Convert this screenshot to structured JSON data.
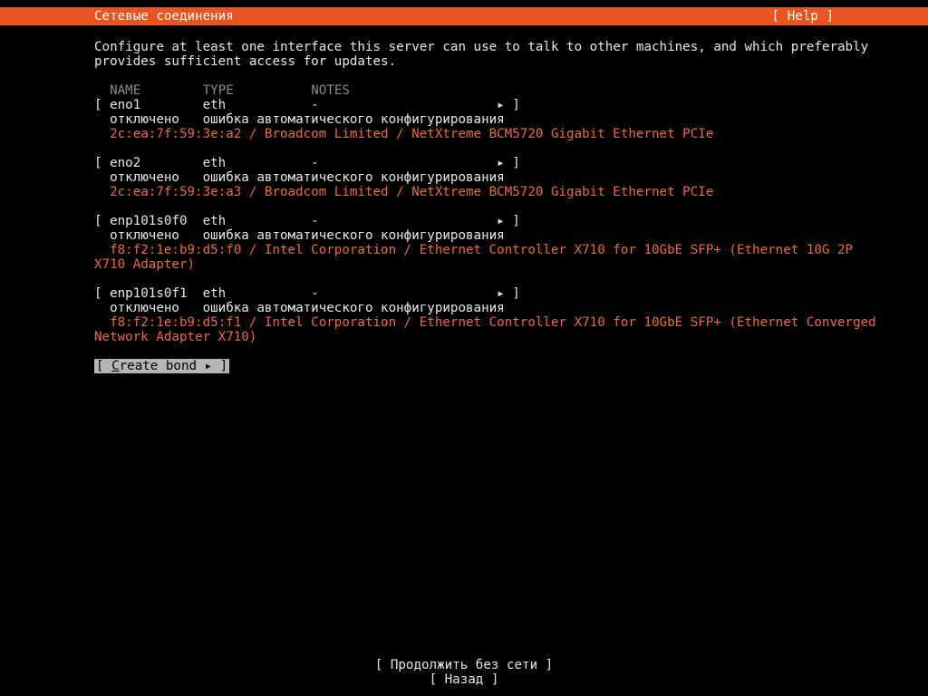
{
  "header": {
    "title": "Сетевые соединения",
    "help": "[ Help ]"
  },
  "intro": "Configure at least one interface this server can use to talk to other machines, and which preferably\nprovides sufficient access for updates.",
  "columns": {
    "name": "NAME",
    "type": "TYPE",
    "notes": "NOTES"
  },
  "interfaces": [
    {
      "name": "eno1",
      "type": "eth",
      "notes": "-",
      "state": "отключено",
      "reason": "ошибка автоматического конфигурирования",
      "hw": "2c:ea:7f:59:3e:a2 / Broadcom Limited / NetXtreme BCM5720 Gigabit Ethernet PCIe"
    },
    {
      "name": "eno2",
      "type": "eth",
      "notes": "-",
      "state": "отключено",
      "reason": "ошибка автоматического конфигурирования",
      "hw": "2c:ea:7f:59:3e:a3 / Broadcom Limited / NetXtreme BCM5720 Gigabit Ethernet PCIe"
    },
    {
      "name": "enp101s0f0",
      "type": "eth",
      "notes": "-",
      "state": "отключено",
      "reason": "ошибка автоматического конфигурирования",
      "hw": "f8:f2:1e:b9:d5:f0 / Intel Corporation / Ethernet Controller X710 for 10GbE SFP+ (Ethernet 10G 2P\nX710 Adapter)"
    },
    {
      "name": "enp101s0f1",
      "type": "eth",
      "notes": "-",
      "state": "отключено",
      "reason": "ошибка автоматического конфигурирования",
      "hw": "f8:f2:1e:b9:d5:f1 / Intel Corporation / Ethernet Controller X710 for 10GbE SFP+ (Ethernet Converged\nNetwork Adapter X710)"
    }
  ],
  "create_bond": {
    "prefix": "[ ",
    "u": "C",
    "rest": "reate bond ▸ ]"
  },
  "footer": {
    "continue": "[ Продолжить без сети   ]",
    "back": "[ Назад                 ]"
  }
}
